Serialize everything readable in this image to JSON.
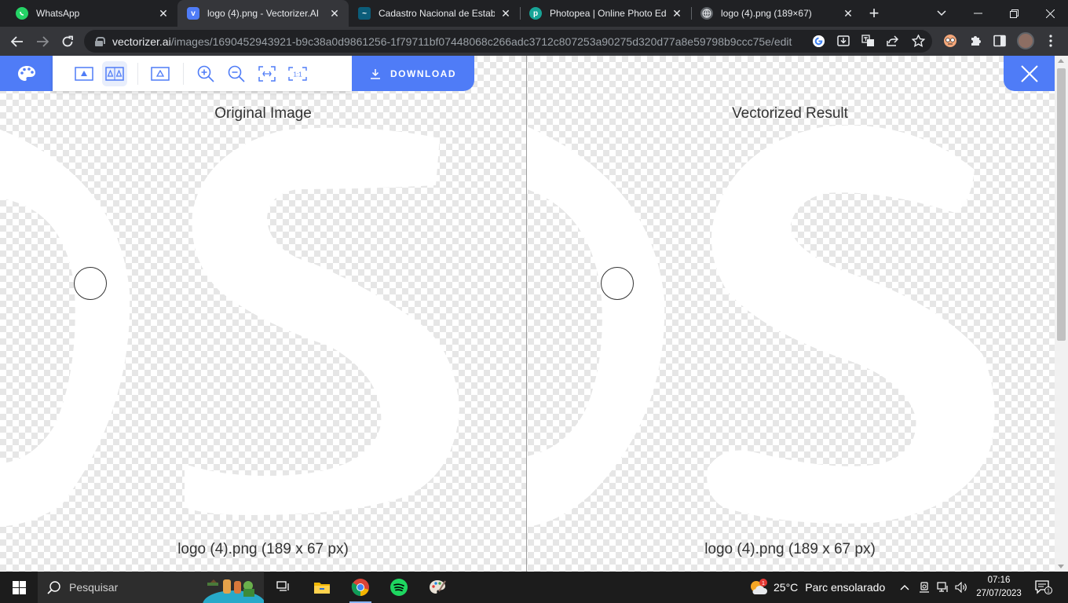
{
  "browser": {
    "tabs": [
      {
        "title": "WhatsApp",
        "favicon": "whatsapp-icon",
        "color": "#25d366"
      },
      {
        "title": "logo (4).png - Vectorizer.AI",
        "favicon": "vectorizer-icon",
        "color": "#4f7cf7"
      },
      {
        "title": "Cadastro Nacional de Estabe",
        "favicon": "cnes-icon",
        "color": "#0b5d7a"
      },
      {
        "title": "Photopea | Online Photo Edit",
        "favicon": "photopea-icon",
        "color": "#18a497"
      },
      {
        "title": "logo (4).png (189×67)",
        "favicon": "globe-icon",
        "color": "#9aa0a6"
      }
    ],
    "active_tab": 1,
    "url_host": "vectorizer.ai",
    "url_path": "/images/1690452943921-b9c38a0d9861256-1f79711bf07448068c266adc3712c807253a90275d320d77a8e59798b9ccc75e/edit"
  },
  "editor": {
    "download_label": "DOWNLOAD",
    "original_title": "Original Image",
    "vectorized_title": "Vectorized Result",
    "original_caption": "logo (4).png (189 x 67 px)",
    "vectorized_caption": "logo (4).png (189 x 67 px)",
    "accent": "#4f7cf7"
  },
  "taskbar": {
    "search_placeholder": "Pesquisar",
    "weather_temp": "25°C",
    "weather_text": "Parc ensolarado",
    "time": "07:16",
    "date": "27/07/2023",
    "notification_count": "1",
    "weather_badge": "1"
  }
}
